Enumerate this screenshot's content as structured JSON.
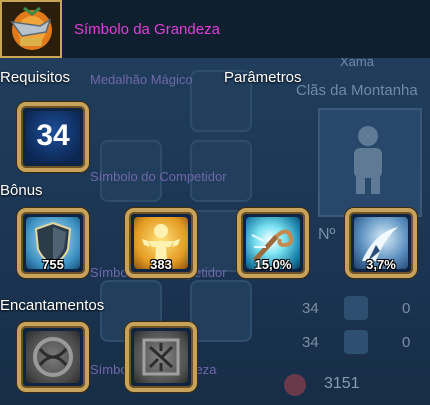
{
  "background": {
    "labels": {
      "medalhao": "Medalhão Mágico",
      "competidor1": "Símbolo do Competidor",
      "competidor2": "Símbolo do Competidor",
      "grandeza": "Símbolo da Grandeza",
      "xama": "Xamã",
      "clas": "Clãs da Montanha",
      "n": "Nº"
    },
    "stats": [
      {
        "value": "34",
        "secondary": "0",
        "icon": "person-icon"
      },
      {
        "value": "34",
        "secondary": "0",
        "icon": "swirl-icon"
      }
    ],
    "hp": "3151"
  },
  "tooltip": {
    "title": "Símbolo da Grandeza",
    "item_icon": "grandeza-symbol-icon",
    "sections": {
      "requirements": "Requisitos",
      "parameters": "Parâmetros",
      "bonus": "Bônus",
      "enchantments": "Encantamentos"
    },
    "required_level": "34",
    "bonuses": [
      {
        "icon": "shield-icon",
        "value": "755"
      },
      {
        "icon": "golden-figure-icon",
        "value": "383"
      },
      {
        "icon": "spiral-icon",
        "value": "15,0%"
      },
      {
        "icon": "swoosh-arrow-icon",
        "value": "3,7%"
      }
    ],
    "enchantments": [
      {
        "icon": "stone-rune-round-icon"
      },
      {
        "icon": "stone-rune-square-icon"
      }
    ]
  },
  "colors": {
    "title": "#e23fd8",
    "frame_gold": "#c6a25b",
    "background": "#1d3450"
  }
}
